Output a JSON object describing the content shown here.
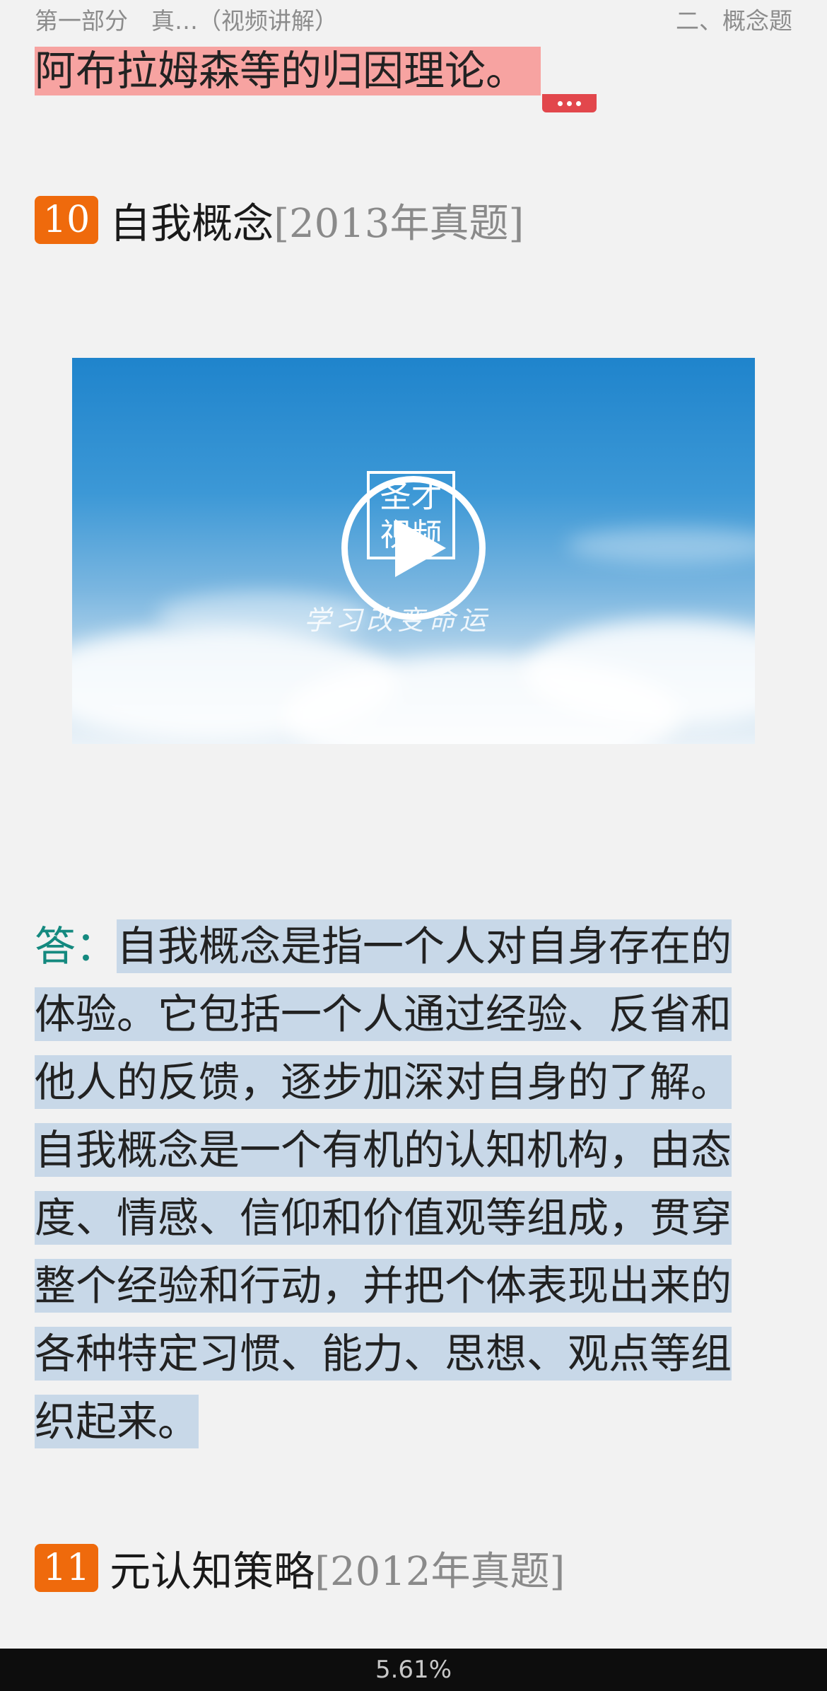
{
  "header": {
    "left": "第一部分　真…（视频讲解）",
    "right": "二、概念题"
  },
  "prev_text": "阿布拉姆森等的归因理论。",
  "questions": [
    {
      "number": "10",
      "title": "自我概念",
      "tag": "[2013年真题]"
    },
    {
      "number": "11",
      "title": "元认知策略",
      "tag": "[2012年真题]"
    }
  ],
  "video": {
    "logo_line1": "圣才",
    "logo_line2": "视频",
    "slogan": "学习改变命运"
  },
  "answer": {
    "label": "答：",
    "text": "自我概念是指一个人对自身存在的体验。它包括一个人通过经验、反省和他人的反馈，逐步加深对自身的了解。自我概念是一个有机的认知机构，由态度、情感、信仰和价值观等组成，贯穿整个经验和行动，并把个体表现出来的各种特定习惯、能力、思想、观点等组织起来。"
  },
  "footer": {
    "progress": "5.61%"
  },
  "colors": {
    "number_badge": "#ef6a0c",
    "answer_label": "#14897f",
    "highlight_red": "#f7a3a1",
    "highlight_blue": "#c8d8e8"
  }
}
